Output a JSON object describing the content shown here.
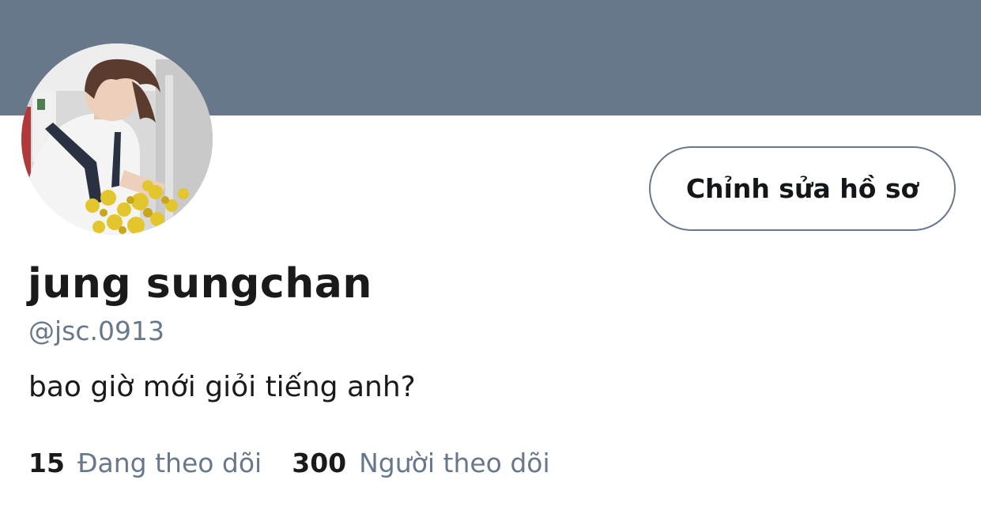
{
  "profile": {
    "banner_color": "#68788a",
    "avatar_alt": "profile-photo",
    "edit_button_label": "Chỉnh sửa hồ sơ",
    "display_name": "jung sungchan",
    "handle": "@jsc.0913",
    "bio": "bao giờ mới giỏi tiếng anh?",
    "stats": {
      "following_count": "15",
      "following_label": "Đang theo dõi",
      "followers_count": "300",
      "followers_label": "Người theo dõi"
    }
  },
  "colors": {
    "muted_text": "#68788a",
    "primary_text": "#1a1a1a",
    "background": "#ffffff"
  }
}
